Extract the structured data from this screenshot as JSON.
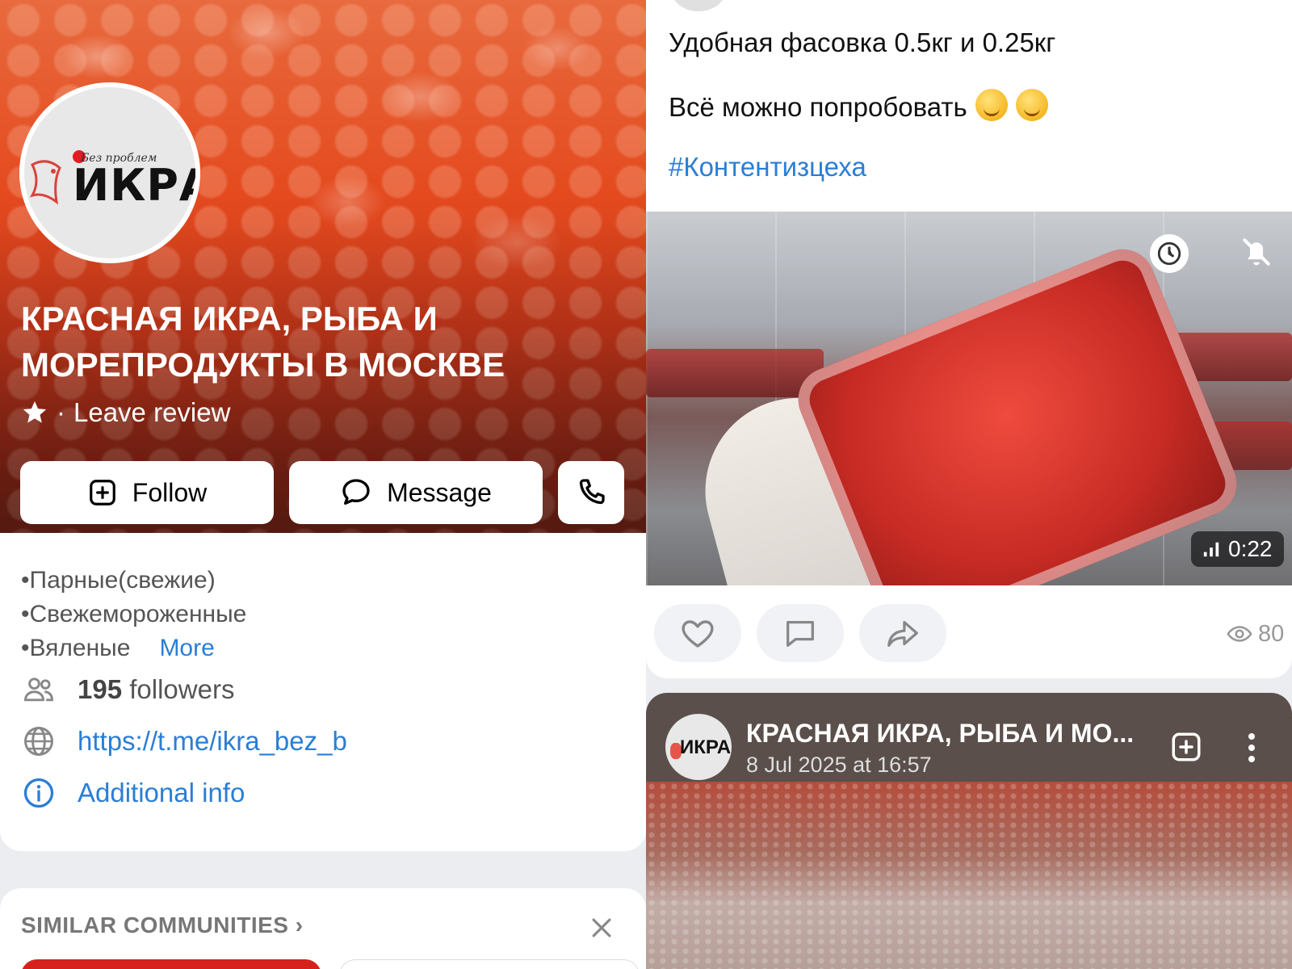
{
  "community": {
    "title": "КРАСНАЯ ИКРА, РЫБА И МОРЕПРОДУКТЫ В МОСКВЕ",
    "logo_small_text": "Без проблем",
    "logo_main_text": "ИКРА",
    "rating_separator": "·",
    "leave_review": "Leave review",
    "buttons": {
      "follow": "Follow",
      "message": "Message"
    },
    "description": {
      "line1": "•Парные(свежие)",
      "line2": "•Свежемороженные",
      "line3": "•Вяленые",
      "more": "More"
    },
    "followers_count": "195",
    "followers_label": "followers",
    "link": "https://t.me/ikra_bez_b",
    "additional_info": "Additional info"
  },
  "similar": {
    "title": "SIMILAR COMMUNITIES",
    "chevron": "›"
  },
  "post": {
    "line1": "Удобная фасовка 0.5кг и 0.25кг",
    "line2": "Всё можно попробовать",
    "hashtag": "#Контентизцеха",
    "video_duration": "0:22",
    "views": "80"
  },
  "post2": {
    "author": "КРАСНАЯ ИКРА, РЫБА И МО...",
    "date": "8 Jul 2025 at 16:57",
    "avatar_text": "ИКРА"
  },
  "icons": {
    "follow": "plus-square-icon",
    "message": "chat-bubble-icon",
    "call": "phone-icon",
    "followers": "people-icon",
    "link": "globe-icon",
    "info": "info-circle-icon",
    "like": "heart-icon",
    "comment": "comment-icon",
    "share": "share-arrow-icon",
    "views": "eye-icon",
    "clock": "clock-icon",
    "mute": "mute-icon"
  },
  "colors": {
    "link_blue": "#2a7ed6",
    "caviar_red": "#d6221d"
  }
}
